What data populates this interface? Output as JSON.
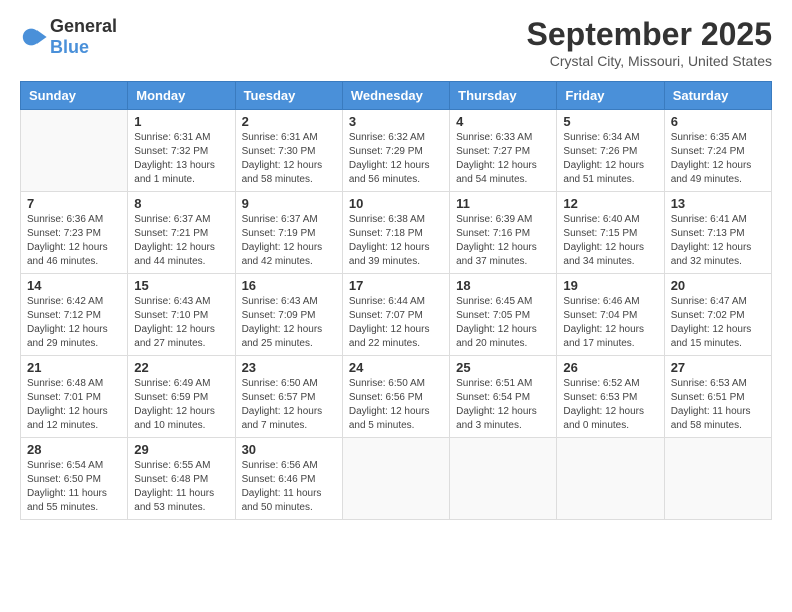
{
  "header": {
    "logo_general": "General",
    "logo_blue": "Blue",
    "month": "September 2025",
    "location": "Crystal City, Missouri, United States"
  },
  "weekdays": [
    "Sunday",
    "Monday",
    "Tuesday",
    "Wednesday",
    "Thursday",
    "Friday",
    "Saturday"
  ],
  "weeks": [
    [
      {
        "day": "",
        "info": ""
      },
      {
        "day": "1",
        "info": "Sunrise: 6:31 AM\nSunset: 7:32 PM\nDaylight: 13 hours\nand 1 minute."
      },
      {
        "day": "2",
        "info": "Sunrise: 6:31 AM\nSunset: 7:30 PM\nDaylight: 12 hours\nand 58 minutes."
      },
      {
        "day": "3",
        "info": "Sunrise: 6:32 AM\nSunset: 7:29 PM\nDaylight: 12 hours\nand 56 minutes."
      },
      {
        "day": "4",
        "info": "Sunrise: 6:33 AM\nSunset: 7:27 PM\nDaylight: 12 hours\nand 54 minutes."
      },
      {
        "day": "5",
        "info": "Sunrise: 6:34 AM\nSunset: 7:26 PM\nDaylight: 12 hours\nand 51 minutes."
      },
      {
        "day": "6",
        "info": "Sunrise: 6:35 AM\nSunset: 7:24 PM\nDaylight: 12 hours\nand 49 minutes."
      }
    ],
    [
      {
        "day": "7",
        "info": "Sunrise: 6:36 AM\nSunset: 7:23 PM\nDaylight: 12 hours\nand 46 minutes."
      },
      {
        "day": "8",
        "info": "Sunrise: 6:37 AM\nSunset: 7:21 PM\nDaylight: 12 hours\nand 44 minutes."
      },
      {
        "day": "9",
        "info": "Sunrise: 6:37 AM\nSunset: 7:19 PM\nDaylight: 12 hours\nand 42 minutes."
      },
      {
        "day": "10",
        "info": "Sunrise: 6:38 AM\nSunset: 7:18 PM\nDaylight: 12 hours\nand 39 minutes."
      },
      {
        "day": "11",
        "info": "Sunrise: 6:39 AM\nSunset: 7:16 PM\nDaylight: 12 hours\nand 37 minutes."
      },
      {
        "day": "12",
        "info": "Sunrise: 6:40 AM\nSunset: 7:15 PM\nDaylight: 12 hours\nand 34 minutes."
      },
      {
        "day": "13",
        "info": "Sunrise: 6:41 AM\nSunset: 7:13 PM\nDaylight: 12 hours\nand 32 minutes."
      }
    ],
    [
      {
        "day": "14",
        "info": "Sunrise: 6:42 AM\nSunset: 7:12 PM\nDaylight: 12 hours\nand 29 minutes."
      },
      {
        "day": "15",
        "info": "Sunrise: 6:43 AM\nSunset: 7:10 PM\nDaylight: 12 hours\nand 27 minutes."
      },
      {
        "day": "16",
        "info": "Sunrise: 6:43 AM\nSunset: 7:09 PM\nDaylight: 12 hours\nand 25 minutes."
      },
      {
        "day": "17",
        "info": "Sunrise: 6:44 AM\nSunset: 7:07 PM\nDaylight: 12 hours\nand 22 minutes."
      },
      {
        "day": "18",
        "info": "Sunrise: 6:45 AM\nSunset: 7:05 PM\nDaylight: 12 hours\nand 20 minutes."
      },
      {
        "day": "19",
        "info": "Sunrise: 6:46 AM\nSunset: 7:04 PM\nDaylight: 12 hours\nand 17 minutes."
      },
      {
        "day": "20",
        "info": "Sunrise: 6:47 AM\nSunset: 7:02 PM\nDaylight: 12 hours\nand 15 minutes."
      }
    ],
    [
      {
        "day": "21",
        "info": "Sunrise: 6:48 AM\nSunset: 7:01 PM\nDaylight: 12 hours\nand 12 minutes."
      },
      {
        "day": "22",
        "info": "Sunrise: 6:49 AM\nSunset: 6:59 PM\nDaylight: 12 hours\nand 10 minutes."
      },
      {
        "day": "23",
        "info": "Sunrise: 6:50 AM\nSunset: 6:57 PM\nDaylight: 12 hours\nand 7 minutes."
      },
      {
        "day": "24",
        "info": "Sunrise: 6:50 AM\nSunset: 6:56 PM\nDaylight: 12 hours\nand 5 minutes."
      },
      {
        "day": "25",
        "info": "Sunrise: 6:51 AM\nSunset: 6:54 PM\nDaylight: 12 hours\nand 3 minutes."
      },
      {
        "day": "26",
        "info": "Sunrise: 6:52 AM\nSunset: 6:53 PM\nDaylight: 12 hours\nand 0 minutes."
      },
      {
        "day": "27",
        "info": "Sunrise: 6:53 AM\nSunset: 6:51 PM\nDaylight: 11 hours\nand 58 minutes."
      }
    ],
    [
      {
        "day": "28",
        "info": "Sunrise: 6:54 AM\nSunset: 6:50 PM\nDaylight: 11 hours\nand 55 minutes."
      },
      {
        "day": "29",
        "info": "Sunrise: 6:55 AM\nSunset: 6:48 PM\nDaylight: 11 hours\nand 53 minutes."
      },
      {
        "day": "30",
        "info": "Sunrise: 6:56 AM\nSunset: 6:46 PM\nDaylight: 11 hours\nand 50 minutes."
      },
      {
        "day": "",
        "info": ""
      },
      {
        "day": "",
        "info": ""
      },
      {
        "day": "",
        "info": ""
      },
      {
        "day": "",
        "info": ""
      }
    ]
  ]
}
